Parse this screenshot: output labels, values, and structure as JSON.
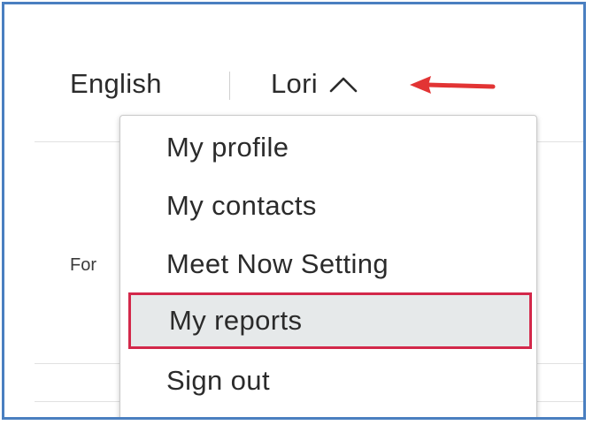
{
  "header": {
    "language_label": "English",
    "user_name": "Lori"
  },
  "page": {
    "truncated_label": "For"
  },
  "user_menu": {
    "items": [
      {
        "label": "My profile",
        "highlighted": false
      },
      {
        "label": "My contacts",
        "highlighted": false
      },
      {
        "label": "Meet Now Setting",
        "highlighted": false
      },
      {
        "label": "My reports",
        "highlighted": true
      },
      {
        "label": "Sign out",
        "highlighted": false
      }
    ]
  },
  "colors": {
    "frame_border": "#4a7fc0",
    "highlight_border": "#d3284a",
    "highlight_fill": "#e6e9ea",
    "arrow": "#e23434"
  },
  "icons": {
    "menu_toggle": "chevron-up-icon",
    "annotation": "arrow-left-icon"
  }
}
